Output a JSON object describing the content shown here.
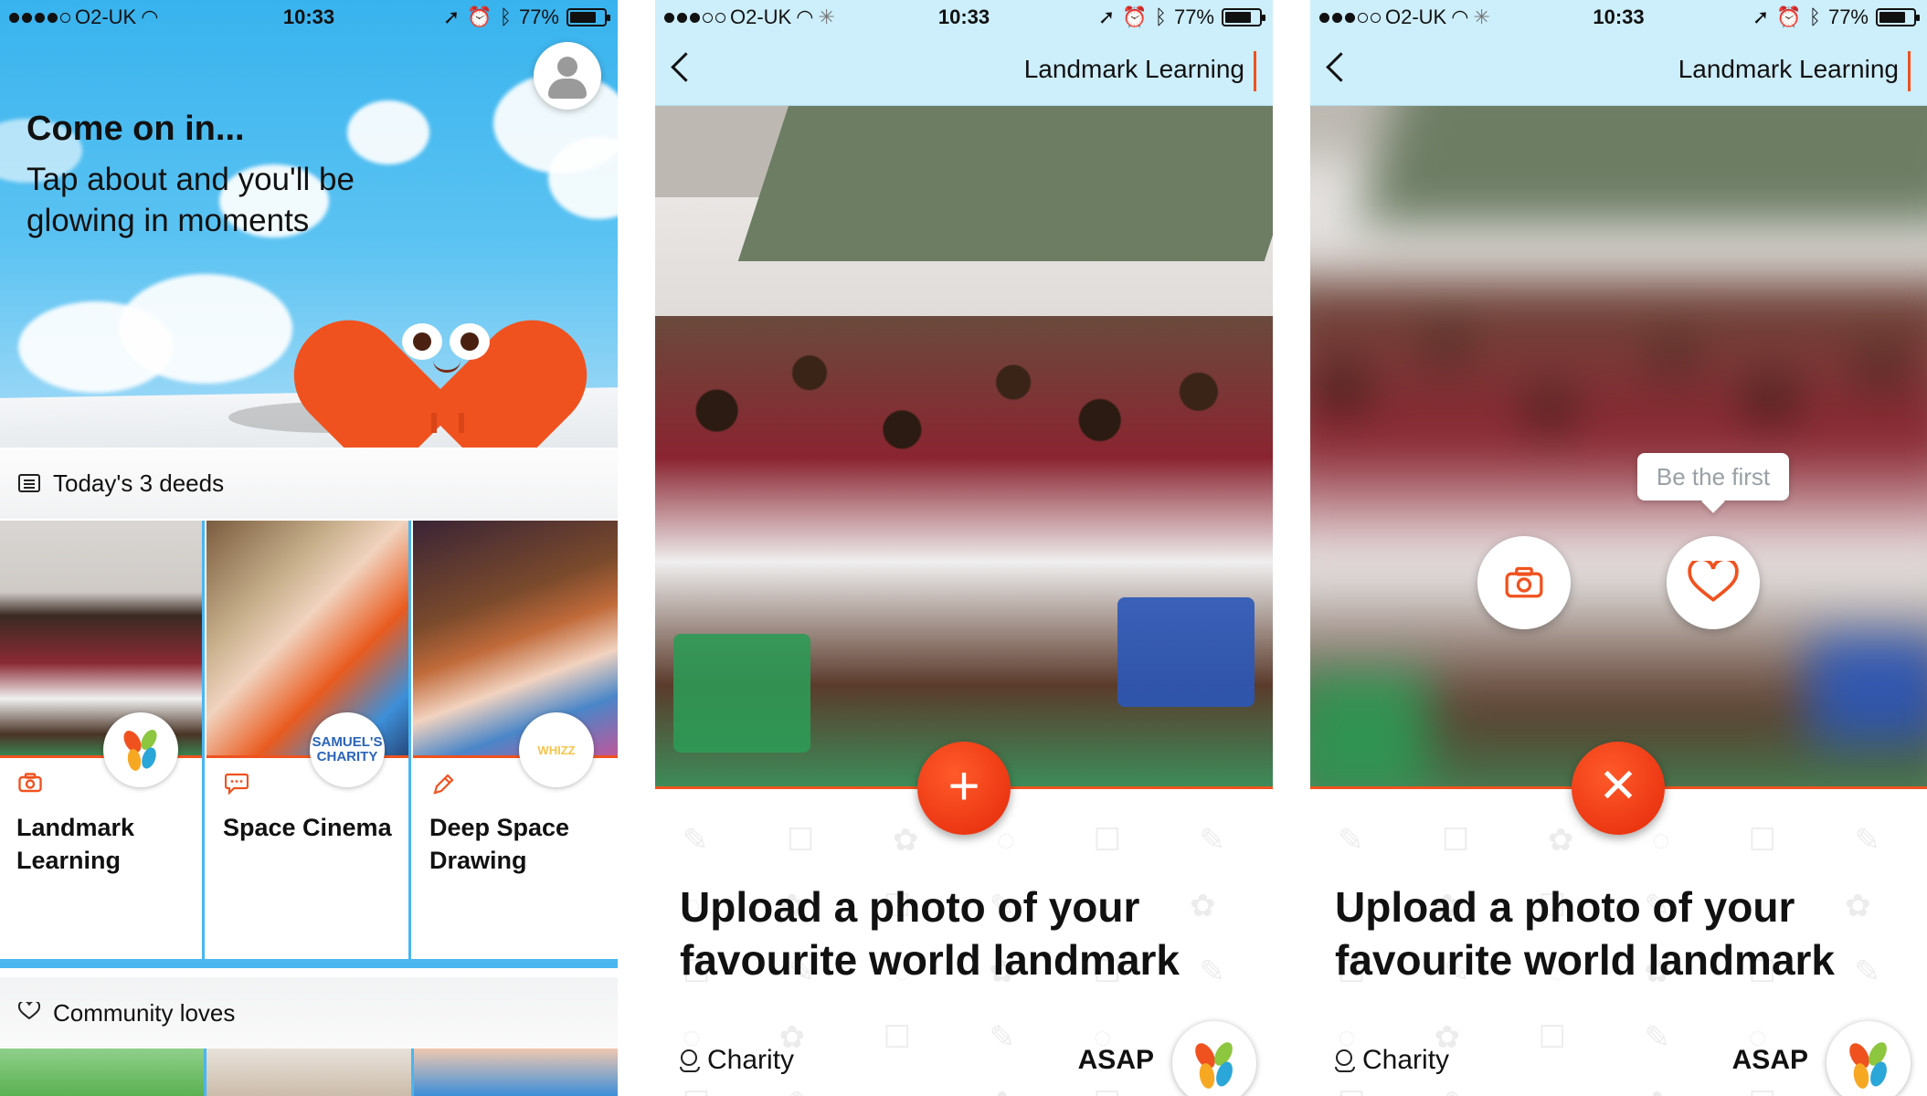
{
  "status": {
    "carrier": "O2-UK",
    "time": "10:33",
    "battery": "77%",
    "battery_level": 0.77
  },
  "home": {
    "title": "Come on in...",
    "subtitle": "Tap about and you'll be glowing in moments",
    "deeds_header": "Today's 3 deeds",
    "deeds": [
      {
        "label": "Landmark Learning",
        "icon": "camera-icon"
      },
      {
        "label": "Space Cinema",
        "icon": "chat-icon",
        "badge_text": "SAMUEL'S CHARITY"
      },
      {
        "label": "Deep Space Drawing",
        "icon": "pencil-icon",
        "badge_text": "WHIZZ"
      }
    ],
    "community_header": "Community loves"
  },
  "detail": {
    "nav_title": "Landmark Learning",
    "task_title": "Upload a photo of your favourite world landmark",
    "category": "Charity",
    "due": "ASAP"
  },
  "overlay": {
    "tooltip": "Be the first"
  },
  "colors": {
    "accent": "#f0521f",
    "sky": "#38b3ee",
    "nav_bg": "#cdeefb"
  }
}
